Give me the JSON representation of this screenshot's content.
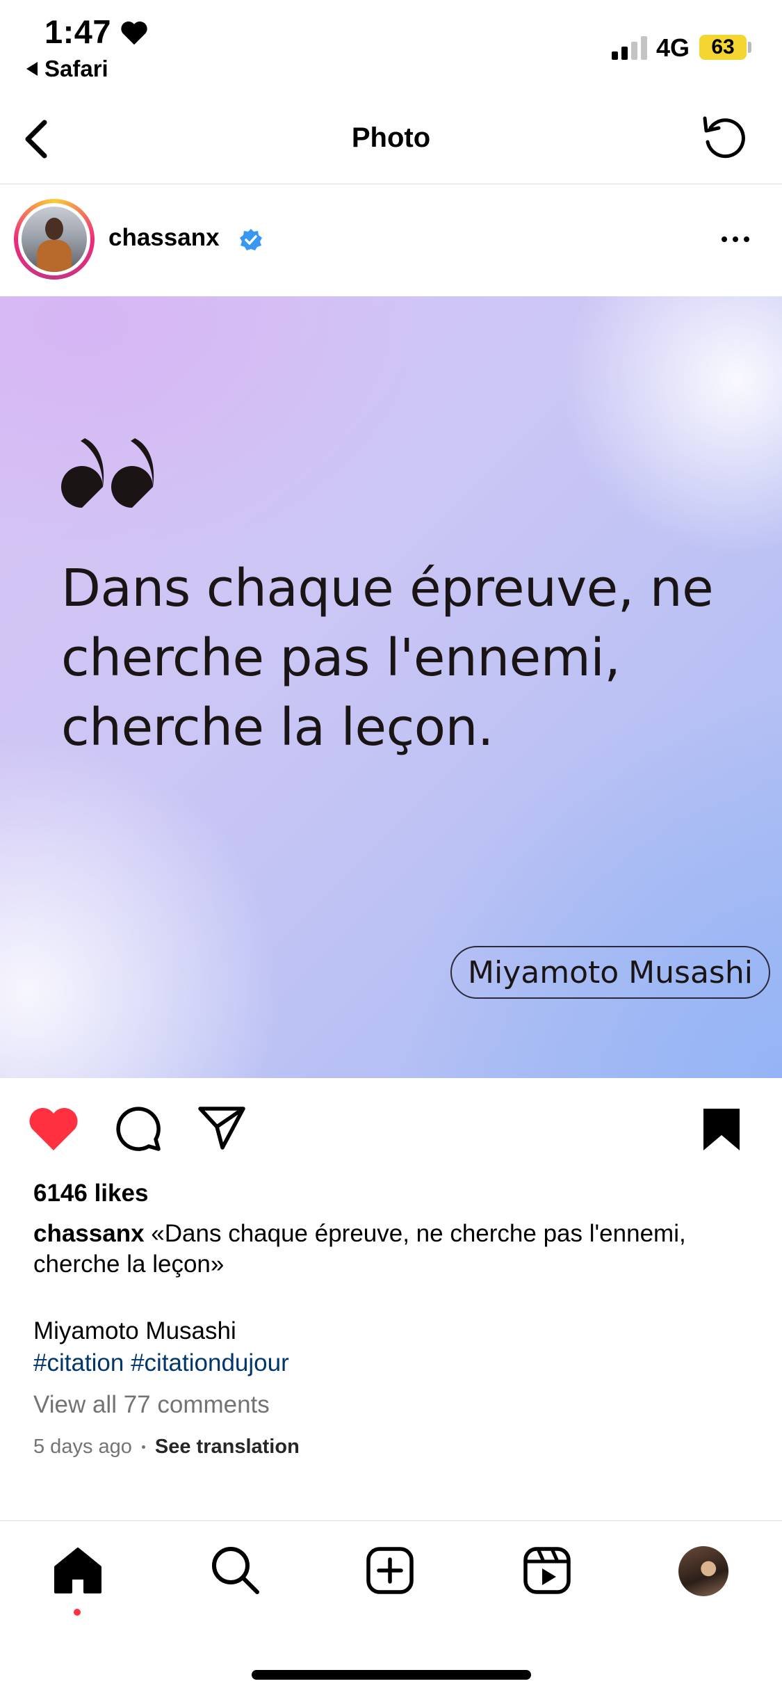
{
  "status_bar": {
    "time": "1:47",
    "back_app": "Safari",
    "network": "4G",
    "battery": "63"
  },
  "header": {
    "title": "Photo"
  },
  "post": {
    "username": "chassanx",
    "quote_text": "Dans chaque épreuve, ne cherche pas l'ennemi, cherche la leçon.",
    "author": "Miyamoto Musashi",
    "likes": "6146 likes",
    "caption_user": "chassanx",
    "caption_text": "«Dans chaque épreuve, ne cherche pas l'ennemi, cherche la leçon»",
    "caption_author": "Miyamoto Musashi",
    "hashtags": "#citation #citationdujour",
    "view_comments": "View all 77 comments",
    "time_ago": "5 days ago",
    "see_translation": "See translation"
  },
  "colors": {
    "like_red": "#ff3040",
    "hashtag_blue": "#00376b",
    "verified_blue": "#3897f0",
    "battery_yellow": "#f5d630"
  }
}
